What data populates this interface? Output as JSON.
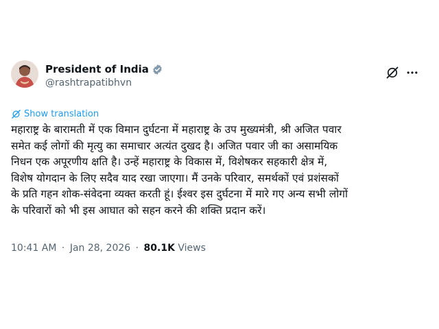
{
  "author": {
    "display_name": "President of India",
    "handle": "@rashtrapatibhvn",
    "verified": true
  },
  "actions": {
    "grok_icon": "grok-icon",
    "more_icon": "more-horizontal-icon"
  },
  "translate": {
    "label": "Show translation"
  },
  "tweet": {
    "lines": [
      "महाराष्ट्र के बारामती में एक विमान दुर्घटना में महाराष्ट्र के उप मुख्यमंत्री, श्री अजित पवार",
      "समेत कई लोगों की मृत्यु का समाचार अत्यंत दुखद है। अजित पवार जी का असामयिक",
      "निधन एक अपूरणीय क्षति है। उन्हें महाराष्ट्र के विकास में, विशेषकर सहकारी क्षेत्र में,",
      "विशेष योगदान के लिए सदैव याद रखा जाएगा। मैं उनके परिवार, समर्थकों एवं प्रशंसकों",
      "के प्रति गहन शोक-संवेदना व्यक्त करती हूं। ईश्वर इस दुर्घटना में मारे गए अन्य सभी लोगों",
      "के परिवारों को भी इस आघात को सहन करने की शक्ति प्रदान करें।"
    ]
  },
  "meta": {
    "time": "10:41 AM",
    "separator": "·",
    "date": "Jan 28, 2026",
    "views_count": "80.1K",
    "views_label": "Views"
  },
  "colors": {
    "link": "#1d9bf0",
    "secondary_text": "#536471",
    "primary_text": "#0f1419",
    "verified_badge": "#829aab"
  }
}
